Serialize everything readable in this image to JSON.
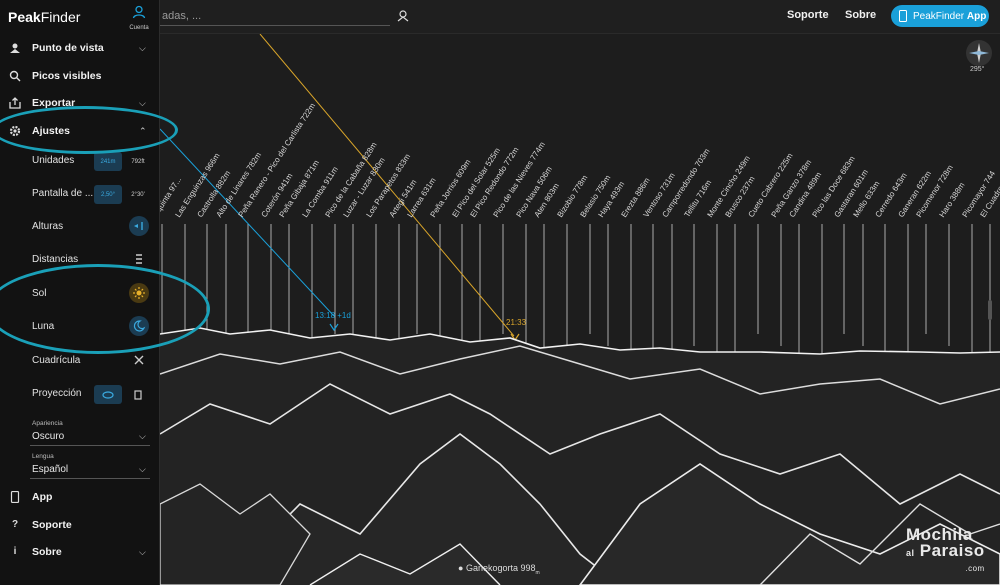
{
  "app": {
    "brand_bold": "Peak",
    "brand_rest": "Finder",
    "account_label": "Cuenta"
  },
  "topbar": {
    "search_placeholder": "adas, ...",
    "links": [
      "Soporte",
      "Sobre"
    ],
    "app_button_prefix": "PeakFinder",
    "app_button_bold": "App"
  },
  "menu": {
    "punto_de_vista": "Punto de vista",
    "picos_visibles": "Picos visibles",
    "exportar": "Exportar",
    "ajustes": "Ajustes",
    "app": "App",
    "soporte": "Soporte",
    "sobre": "Sobre"
  },
  "settings": {
    "unidades": {
      "label": "Unidades",
      "option_a": "241m",
      "option_b": "792ft"
    },
    "pantalla": {
      "label": "Pantalla de ...",
      "option_a": "2,50°",
      "option_b": "2°30'"
    },
    "alturas": "Alturas",
    "distancias": "Distancias",
    "sol": "Sol",
    "luna": "Luna",
    "cuadricula": "Cuadrícula",
    "proyeccion": "Proyección",
    "apariencia": {
      "label": "Apariencia",
      "value": "Oscuro"
    },
    "lengua": {
      "label": "Lengua",
      "value": "Español"
    }
  },
  "compass": {
    "heading": "295°"
  },
  "sun": {
    "time": "13:18 +1d"
  },
  "moon": {
    "time": "21:33"
  },
  "viewpoint": {
    "name": "Ganekogorta 998",
    "unit": "m"
  },
  "watermark": {
    "line1": "Mochila",
    "line2": "al",
    "line3": "Paraiso",
    "tld": ".com"
  },
  "peaks": [
    "...quinta 97...",
    "Las Enguinzas 966m",
    "Castrolla 882m",
    "Alto de Linares 782m",
    "Peña Ranero - Pico del Carlista 722m",
    "Coterón 941m",
    "Peña Gibaja 871m",
    "La Comba 911m",
    "Pico de la Cabaña 828m",
    "Luzar - Luzar 830m",
    "Los Parapetos 833m",
    "Artegi 541m",
    "Larrea 631m",
    "Peña Jorrios 609m",
    "El Pico del Solar 525m",
    "El Pico Redondo 772m",
    "Pico de las Nieves 774m",
    "Pico Nava 506m",
    "Aten 803m",
    "Bizobio 778m",
    "Belasio 750m",
    "Haya 493m",
    "Erezta 886m",
    "Ventoso 731m",
    "Camporredondo 703m",
    "Tellitu 716m",
    "Monte Cincho 249m",
    "Brusco 237m",
    "Cueto Cabrero 225m",
    "Peña Ganzo 378m",
    "Candina 489m",
    "Pico las Doce 683m",
    "Gastaran 601m",
    "Mello 633m",
    "Cerredo 643m",
    "Ganeran 622m",
    "Picomenor 728m",
    "Haro 388m",
    "Picomayor 744",
    "El Cuadro"
  ]
}
